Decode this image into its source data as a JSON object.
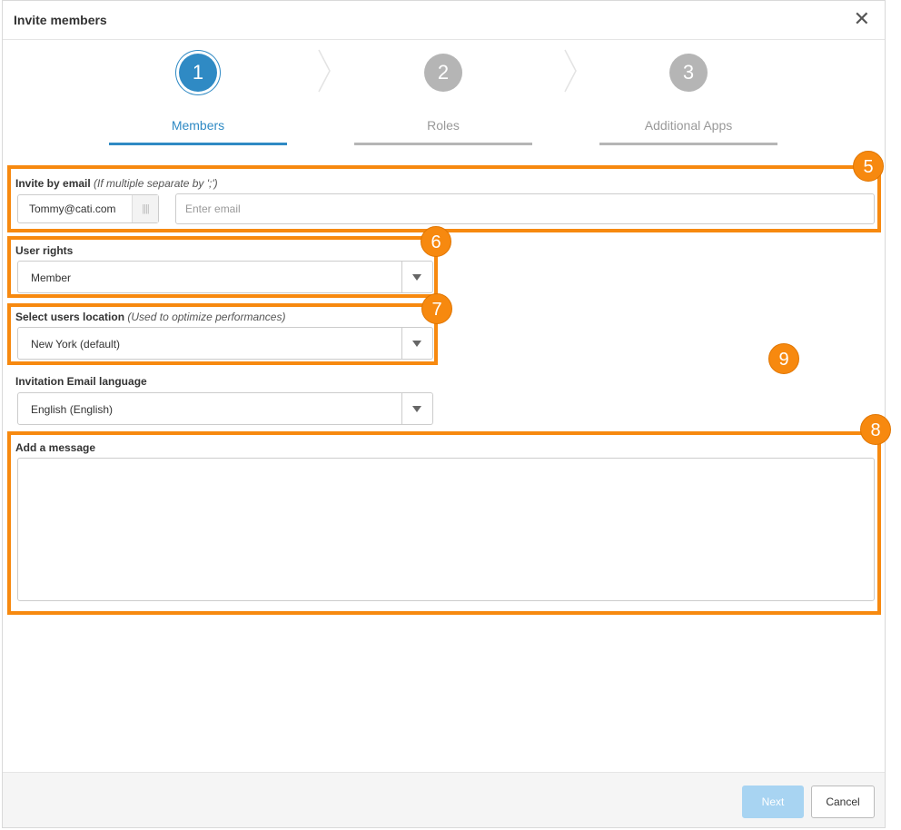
{
  "dialog": {
    "title": "Invite members",
    "close_glyph": "✕"
  },
  "wizard": {
    "steps": [
      {
        "number": "1",
        "label": "Members",
        "state": "active"
      },
      {
        "number": "2",
        "label": "Roles",
        "state": "inactive"
      },
      {
        "number": "3",
        "label": "Additional Apps",
        "state": "inactive"
      }
    ]
  },
  "form": {
    "invite": {
      "label": "Invite by email",
      "hint": "(If multiple separate by ';')",
      "tags": [
        "Tommy@cati.com"
      ],
      "placeholder": "Enter email"
    },
    "user_rights": {
      "label": "User rights",
      "selected": "Member"
    },
    "location": {
      "label": "Select users location",
      "hint": "(Used to optimize performances)",
      "selected": "New York (default)"
    },
    "language": {
      "label": "Invitation Email language",
      "selected": "English (English)"
    },
    "message": {
      "label": "Add a message",
      "value": ""
    }
  },
  "footer": {
    "next_label": "Next",
    "cancel_label": "Cancel"
  },
  "annotations": {
    "color": "#f7890f",
    "badges": [
      "5",
      "6",
      "7",
      "8",
      "9"
    ]
  },
  "colors": {
    "accent": "#2f8ac4",
    "inactive": "#b5b5b5",
    "next_button": "#a8d4f2"
  }
}
